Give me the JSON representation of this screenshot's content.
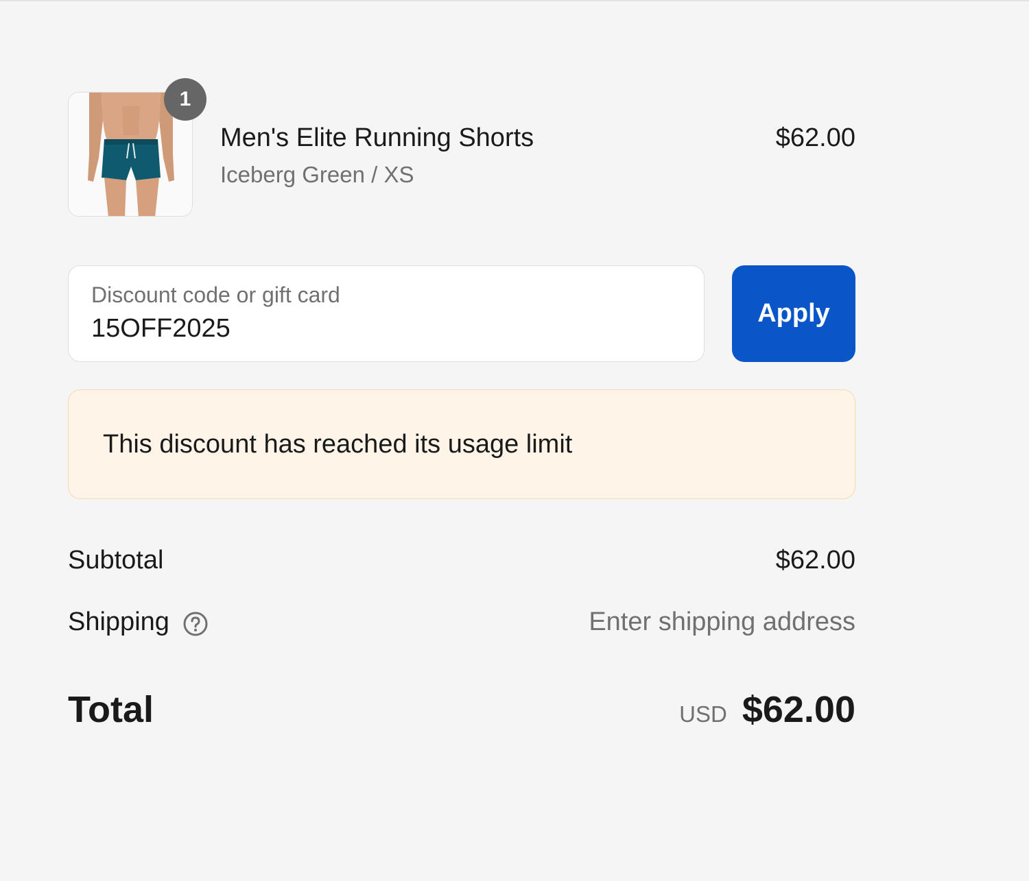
{
  "line_item": {
    "quantity": "1",
    "title": "Men's Elite Running Shorts",
    "variant": "Iceberg Green / XS",
    "price": "$62.00",
    "image_icon": "product-photo-running-shorts",
    "shorts_color": "#0f5a6e"
  },
  "discount": {
    "label": "Discount code or gift card",
    "value": "15OFF2025",
    "apply_label": "Apply",
    "button_color": "#0a56c9"
  },
  "warning": {
    "message": "This discount has reached its usage limit",
    "background": "#fff4e8"
  },
  "totals": {
    "subtotal_label": "Subtotal",
    "subtotal_value": "$62.00",
    "shipping_label": "Shipping",
    "shipping_help_icon": "question-circle-icon",
    "shipping_value": "Enter shipping address",
    "total_label": "Total",
    "currency": "USD",
    "total_value": "$62.00"
  }
}
